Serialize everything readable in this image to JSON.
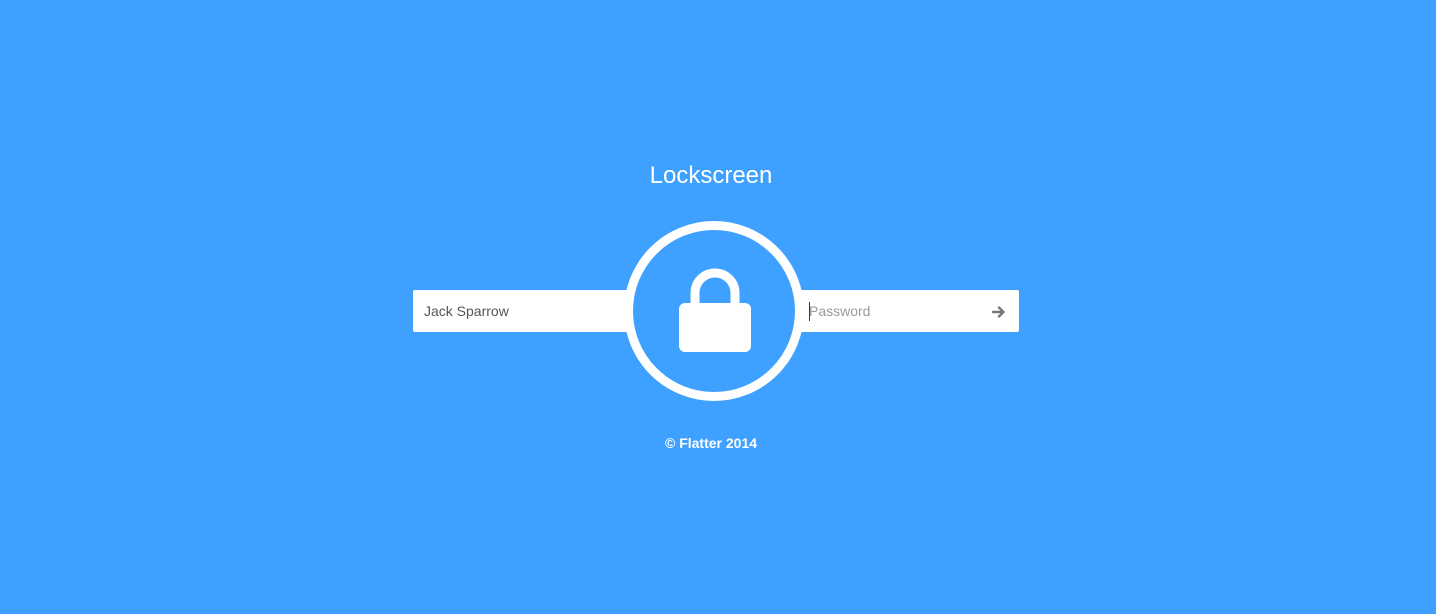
{
  "title": "Lockscreen",
  "username": {
    "value": "Jack Sparrow"
  },
  "password": {
    "placeholder": "Password",
    "value": ""
  },
  "submit_icon": "arrow-right-icon",
  "center_icon": "padlock-icon",
  "footer": "© Flatter 2014",
  "colors": {
    "background": "#3fa1ff",
    "foreground": "#ffffff",
    "input_text": "#555555",
    "placeholder": "#9a9a9a",
    "arrow": "#777777"
  }
}
